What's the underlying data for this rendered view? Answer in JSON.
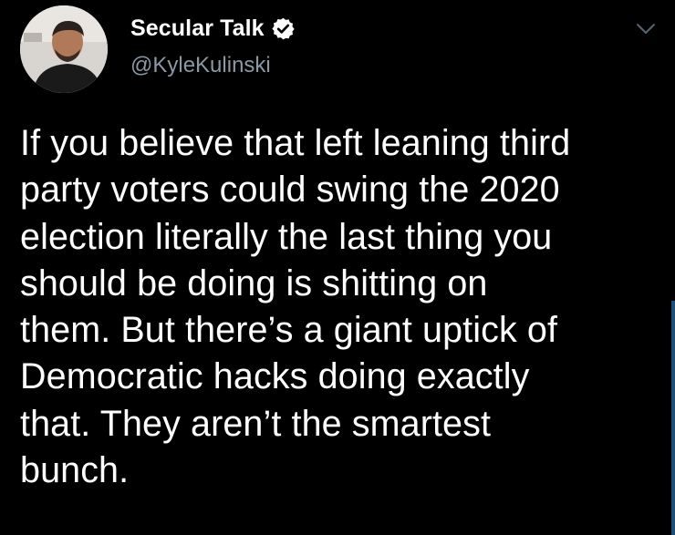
{
  "tweet": {
    "author": {
      "display_name": "Secular Talk",
      "handle": "@KyleKulinski",
      "verified": true,
      "avatar_icon": "user-avatar-photo"
    },
    "menu_icon": "chevron-down-icon",
    "text": "If you believe that left leaning third\nparty voters could swing the 2020\nelection literally the last thing you\nshould be doing is shitting on\nthem. But there’s a giant uptick of\nDemocratic hacks doing exactly\nthat. They aren’t the smartest\nbunch."
  },
  "colors": {
    "background": "#000000",
    "text_primary": "#ffffff",
    "text_secondary": "#8b98a5",
    "verified_badge": "#ffffff"
  }
}
